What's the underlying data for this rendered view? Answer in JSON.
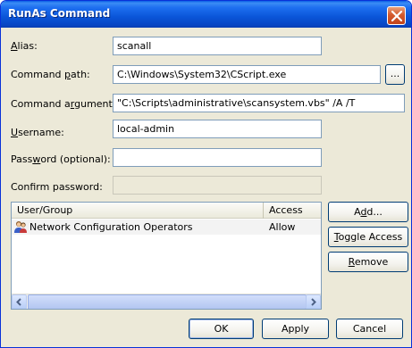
{
  "window": {
    "title": "RunAs Command"
  },
  "form": {
    "alias": {
      "label_ul": "A",
      "label_rest": "lias:",
      "value": "scanall"
    },
    "command_path": {
      "label_pre": "Command ",
      "label_ul": "p",
      "label_rest": "ath:",
      "value": "C:\\Windows\\System32\\CScript.exe",
      "browse_label": "..."
    },
    "command_arguments": {
      "label_pre": "Command a",
      "label_ul": "r",
      "label_rest": "guments:",
      "value": "\"C:\\Scripts\\administrative\\scansystem.vbs\"  /A  /T"
    },
    "username": {
      "label_ul": "U",
      "label_rest": "sername:",
      "value": "local-admin"
    },
    "password": {
      "label_pre": "Pass",
      "label_ul": "w",
      "label_rest": "ord (optional):",
      "value": ""
    },
    "confirm_password": {
      "label": "Confirm password:",
      "value": ""
    }
  },
  "access_list": {
    "columns": [
      "User/Group",
      "Access"
    ],
    "rows": [
      {
        "user": "Network Configuration Operators",
        "access": "Allow",
        "icon": "users-group-icon"
      }
    ]
  },
  "side_buttons": {
    "add": {
      "pre": "A",
      "ul": "d",
      "rest": "d..."
    },
    "toggle": {
      "ul": "T",
      "rest": "oggle Access"
    },
    "remove": {
      "ul": "R",
      "rest": "emove"
    }
  },
  "footer": {
    "ok": "OK",
    "apply": "Apply",
    "cancel": "Cancel"
  }
}
